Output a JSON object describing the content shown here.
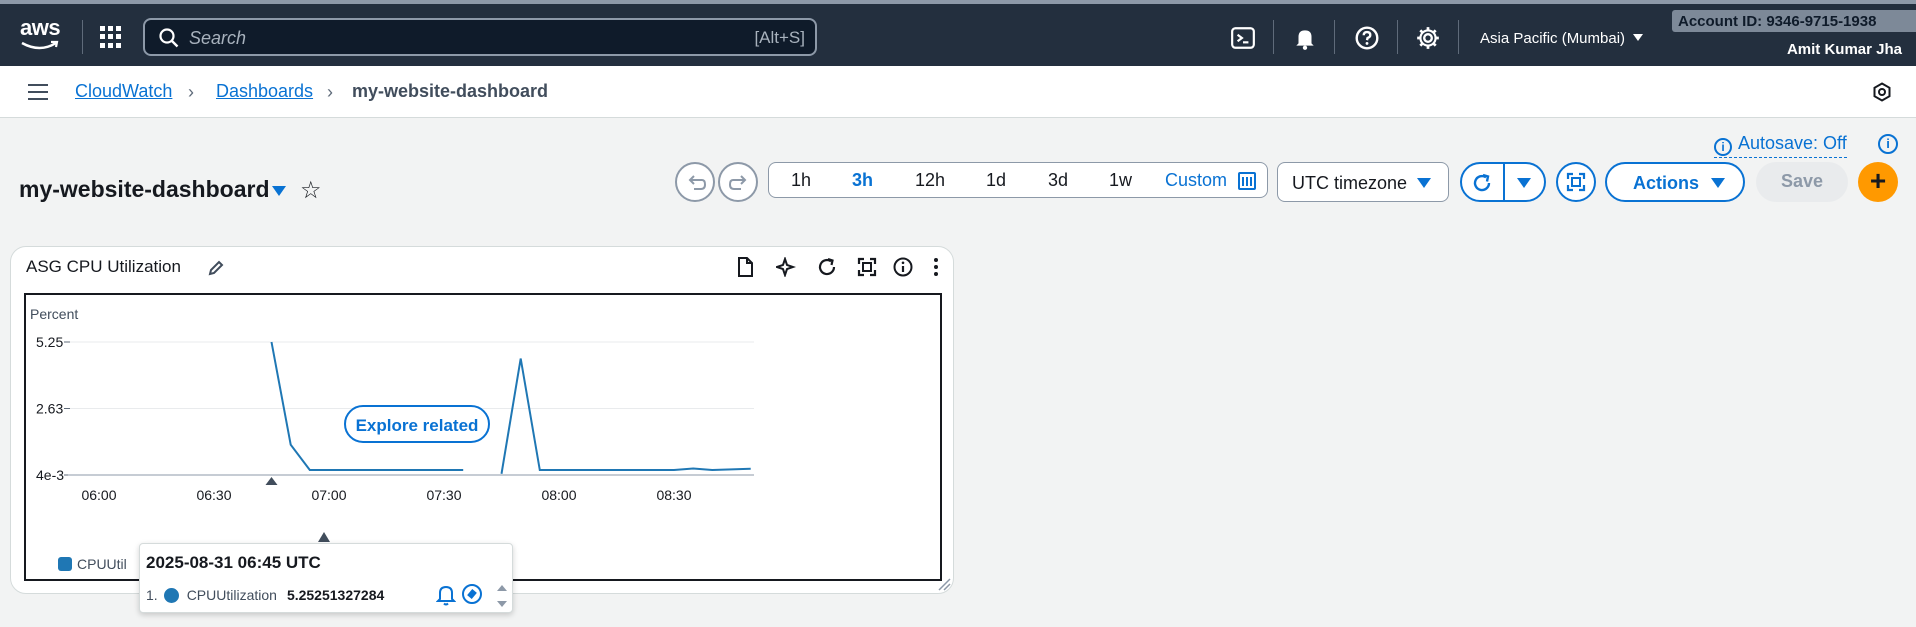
{
  "topbar": {
    "logo_text": "aws",
    "search_placeholder": "Search",
    "search_shortcut": "[Alt+S]",
    "region": "Asia Pacific (Mumbai)",
    "account_id": "Account ID: 9346-9715-1938",
    "user_name": "Amit Kumar Jha"
  },
  "breadcrumb": {
    "items": [
      "CloudWatch",
      "Dashboards"
    ],
    "current": "my-website-dashboard"
  },
  "header": {
    "dashboard_title": "my-website-dashboard",
    "autosave": "Autosave: Off",
    "time_ranges": [
      "1h",
      "3h",
      "12h",
      "1d",
      "3d",
      "1w"
    ],
    "active_range": "3h",
    "custom_label": "Custom",
    "timezone": "UTC timezone",
    "actions_label": "Actions",
    "save_label": "Save"
  },
  "widget": {
    "title": "ASG CPU Utilization",
    "explore_label": "Explore related",
    "legend_label": "CPUUtil"
  },
  "chart_data": {
    "type": "line",
    "ylabel": "Percent",
    "y_ticks": [
      "5.25",
      "2.63",
      "4e-3"
    ],
    "x_ticks": [
      "06:00",
      "06:30",
      "07:00",
      "07:30",
      "08:00",
      "08:30"
    ],
    "ylim": [
      0.004,
      5.25
    ],
    "grid": true,
    "series": [
      {
        "name": "CPUUtilization",
        "color": "#1f77b4",
        "segments": [
          [
            [
              "06:45",
              5.25
            ],
            [
              "06:50",
              1.2
            ],
            [
              "06:55",
              0.2
            ],
            [
              "07:00",
              0.2
            ],
            [
              "07:30",
              0.2
            ],
            [
              "07:35",
              0.2
            ]
          ],
          [
            [
              "07:45",
              0.05
            ],
            [
              "07:50",
              4.6
            ],
            [
              "07:55",
              0.2
            ],
            [
              "08:00",
              0.2
            ],
            [
              "08:30",
              0.2
            ],
            [
              "08:35",
              0.26
            ],
            [
              "08:40",
              0.2
            ],
            [
              "08:50",
              0.25
            ]
          ]
        ]
      }
    ]
  },
  "tooltip": {
    "timestamp": "2025-08-31 06:45 UTC",
    "index": "1.",
    "metric": "CPUUtilization",
    "value": "5.25251327284"
  },
  "colors": {
    "topbar_bg": "#232f3e",
    "accent": "#0972d3",
    "add_button": "#ff9900",
    "series": "#1f77b4"
  }
}
